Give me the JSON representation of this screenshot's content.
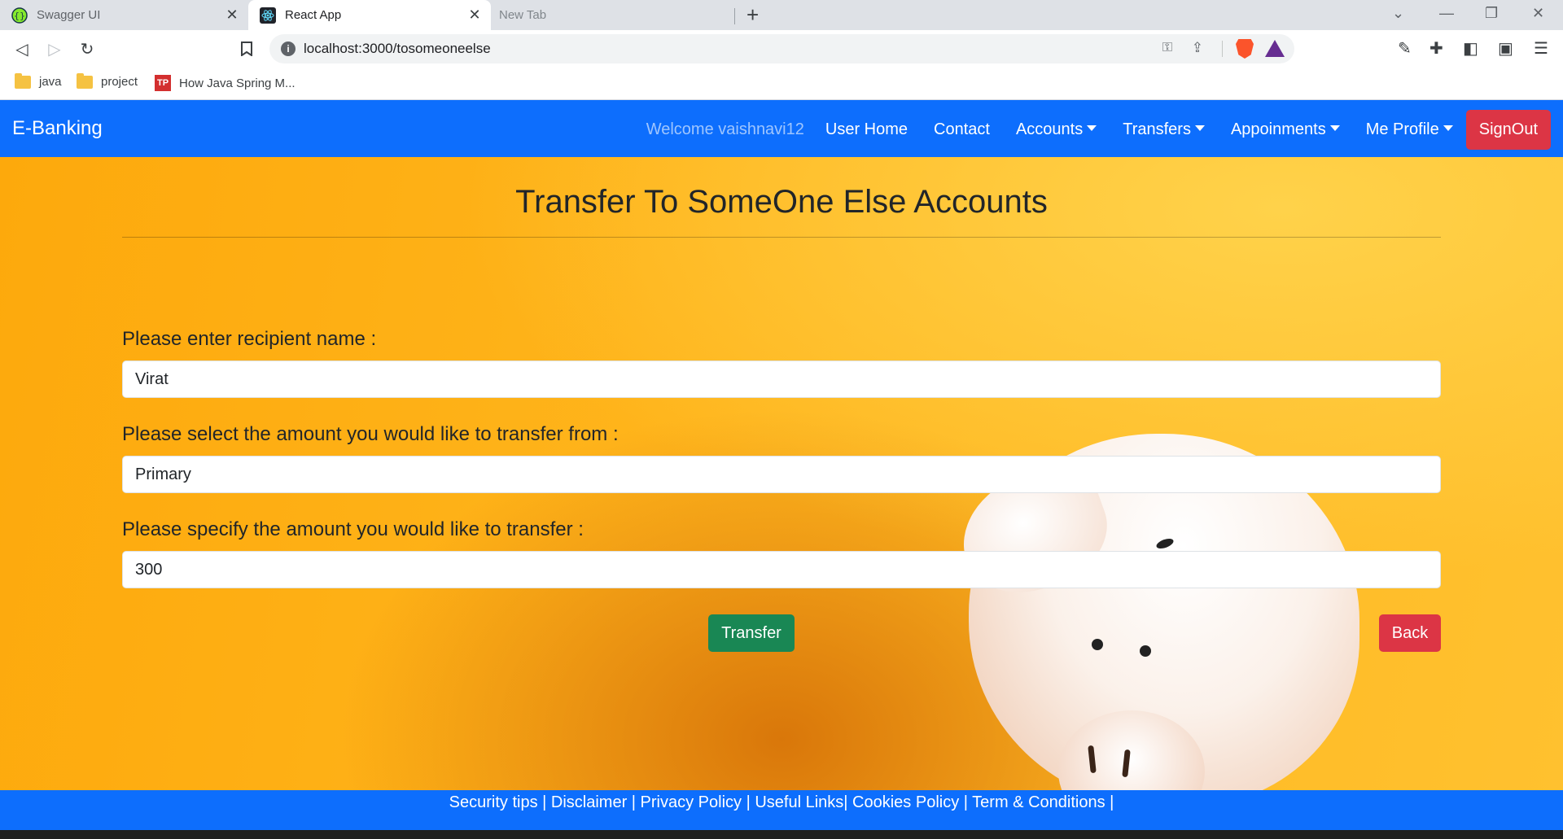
{
  "browser": {
    "tabs": [
      {
        "title": "Swagger UI",
        "icon": "swagger-icon"
      },
      {
        "title": "React App",
        "icon": "react-icon",
        "active": true
      },
      {
        "title": "New Tab",
        "icon": ""
      }
    ],
    "url": "localhost:3000/tosomeoneelse",
    "bookmarks": [
      {
        "label": "java",
        "icon": "folder-icon"
      },
      {
        "label": "project",
        "icon": "folder-icon"
      },
      {
        "label": "How Java Spring M...",
        "icon": "tp-icon",
        "badge": "TP"
      }
    ]
  },
  "navbar": {
    "brand": "E-Banking",
    "welcome": "Welcome vaishnavi12",
    "items": [
      {
        "label": "User Home",
        "dropdown": false
      },
      {
        "label": "Contact",
        "dropdown": false
      },
      {
        "label": "Accounts",
        "dropdown": true
      },
      {
        "label": "Transfers",
        "dropdown": true
      },
      {
        "label": "Appoinments",
        "dropdown": true
      },
      {
        "label": "Me Profile",
        "dropdown": true
      }
    ],
    "signout": "SignOut"
  },
  "page": {
    "title": "Transfer To SomeOne Else Accounts",
    "fields": [
      {
        "label": "Please enter recipient name :",
        "value": "Virat"
      },
      {
        "label": "Please select the amount you would like to transfer from :",
        "value": "Primary"
      },
      {
        "label": "Please specify the amount you would like to transfer :",
        "value": "300"
      }
    ],
    "transfer_button": "Transfer",
    "back_button": "Back"
  },
  "footer": {
    "links": [
      "Security tips",
      "Disclaimer",
      "Privacy Policy",
      "Useful Links",
      "Cookies Policy",
      "Term & Conditions"
    ]
  },
  "colors": {
    "navbar": "#0d6efd",
    "signout": "#dc3545",
    "transfer": "#198754",
    "back": "#dc3545",
    "background": "#ffb51c"
  }
}
